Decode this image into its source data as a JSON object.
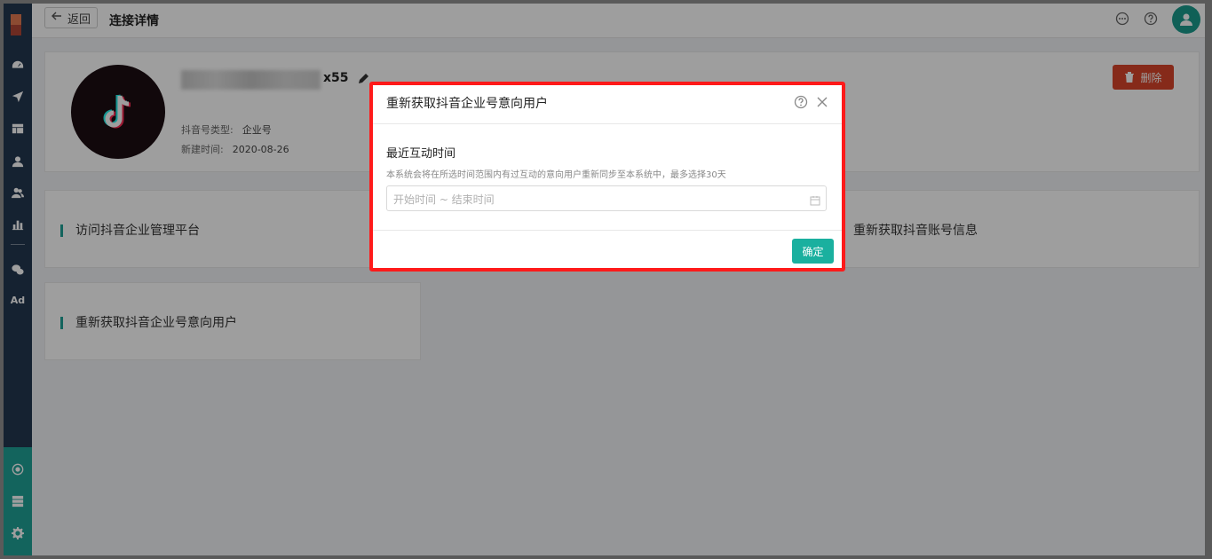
{
  "topbar": {
    "back_label": "返回",
    "page_title": "连接详情"
  },
  "profile": {
    "name_suffix": "x55",
    "type_label": "抖音号类型:",
    "type_value": "企业号",
    "created_label": "新建时间:",
    "created_value": "2020-08-26",
    "delete_label": "删除"
  },
  "links": {
    "visit_platform": "访问抖音企业管理平台",
    "refresh_account": "重新获取抖音账号信息",
    "refresh_intent": "重新获取抖音企业号意向用户"
  },
  "sidebar": {
    "ad_label": "Ad"
  },
  "modal": {
    "title": "重新获取抖音企业号意向用户",
    "field_label": "最近互动时间",
    "hint": "本系统会将在所选时间范围内有过互动的意向用户重新同步至本系统中，最多选择30天",
    "date_placeholder": "开始时间 ~ 结束时间",
    "confirm_label": "确定"
  },
  "colors": {
    "sidebar": "#23374f",
    "accent": "#1fa296",
    "delete": "#d8442a",
    "highlight": "#ff1a1a"
  }
}
